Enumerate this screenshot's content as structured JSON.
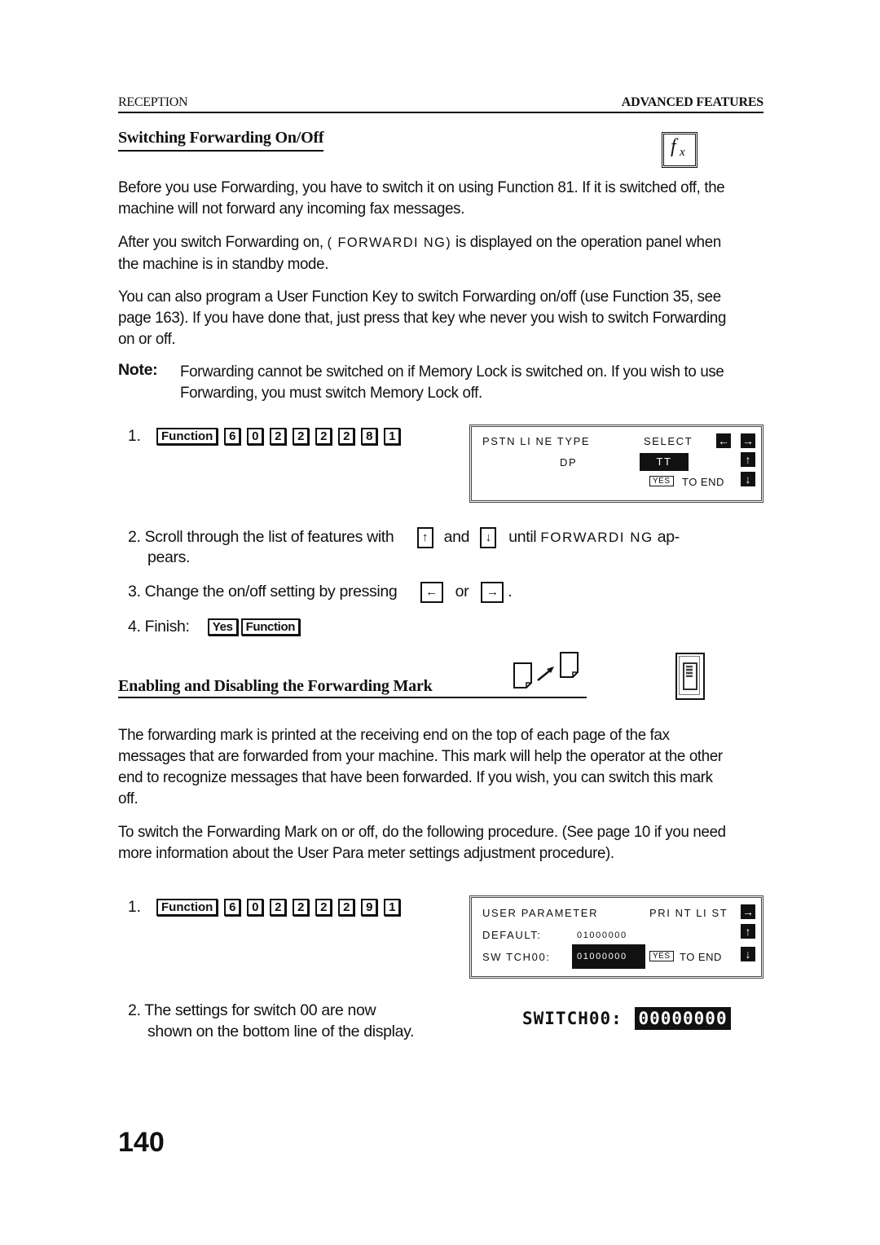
{
  "header": {
    "left": "RECEPTION",
    "right": "ADVANCED FEATURES"
  },
  "section1": {
    "title": "Switching Forwarding On/Off",
    "icon": "function-fx-icon",
    "paragraphs": {
      "p1": "Before you use Forwarding, you have to switch it on using Function 81. If it is switched off, the machine will not forward any incoming fax messages.",
      "p2_before": "After you switch Forwarding on,",
      "p2_lcd": "( FORWARDI NG)",
      "p2_after": "is displayed on the operation panel when the machine is in standby mode.",
      "p3": "You can also program a User Function Key to switch Forwarding on/off (use Function 35, see page  163). If you have done that, just press that key whe  never you wish to switch Forwarding on or off."
    },
    "note": {
      "label": "Note:",
      "text": "Forwarding cannot be switched on if Memory Lock is switched on. If you wish to use Forwarding, you must switch Memory Lock off."
    },
    "steps": {
      "s1_num": "1.",
      "s1_keys": [
        "Function",
        "6",
        "0",
        "2",
        "2",
        "2",
        "2",
        "8",
        "1"
      ],
      "s2_text_a": "2. Scroll through the list of features with",
      "s2_up": "↑",
      "s2_and": "and",
      "s2_down": "↓",
      "s2_until": "until",
      "s2_lcd": "FORWARDI NG",
      "s2_text_b": "ap-",
      "s2_text_c": "pears.",
      "s3_text": "3. Change the on/off setting by pressing",
      "s3_left": "←",
      "s3_or": "or",
      "s3_right": "→",
      "s3_end": ".",
      "s4_text": "4. Finish:",
      "s4_keys": [
        "Yes",
        "Function"
      ]
    },
    "lcd": {
      "row1_left": "PSTN LI NE TYPE",
      "row1_right": "SELECT",
      "row2_left": "DP",
      "row2_selected": "TT",
      "row3_yes": "YES",
      "row3_text": "TO END",
      "arrows": [
        "←",
        "→",
        "↑",
        "↓"
      ]
    }
  },
  "section2": {
    "title": "Enabling and Disabling the Forwarding Mark",
    "icons": [
      "forward-document-icon",
      "switch-panel-icon"
    ],
    "p1": "The forwarding mark is printed at the receiving end on the top of each page of the fax messages that are forwarded from your machine. This mark will help the operator at the other end to recognize messages that have been forwarded. If you wish, you can switch this mark off.",
    "p2": "To switch the Forwarding Mark on or off, do the following procedure. (See page 10 if you need more information about the User Para  meter settings adjustment procedure).",
    "steps": {
      "s1_num": "1.",
      "s1_keys": [
        "Function",
        "6",
        "0",
        "2",
        "2",
        "2",
        "2",
        "9",
        "1"
      ],
      "s2_line1": "2.  The settings for switch 00 are now",
      "s2_line2": "shown on the bottom line of the display."
    },
    "lcd": {
      "row1_left": "USER PARAMETER",
      "row1_right": "PRI NT LI ST",
      "row2_label": "DEFAULT:",
      "row2_value": "01000000",
      "row3_label": "SW TCH00:",
      "row3_value": "01000000",
      "row3_yes": "YES",
      "row3_text": "TO END",
      "arrows": [
        "→",
        "↑",
        "↓"
      ]
    },
    "switch_readout": {
      "label": "SWITCH00:",
      "value": "00000000"
    }
  },
  "page_number": "140"
}
